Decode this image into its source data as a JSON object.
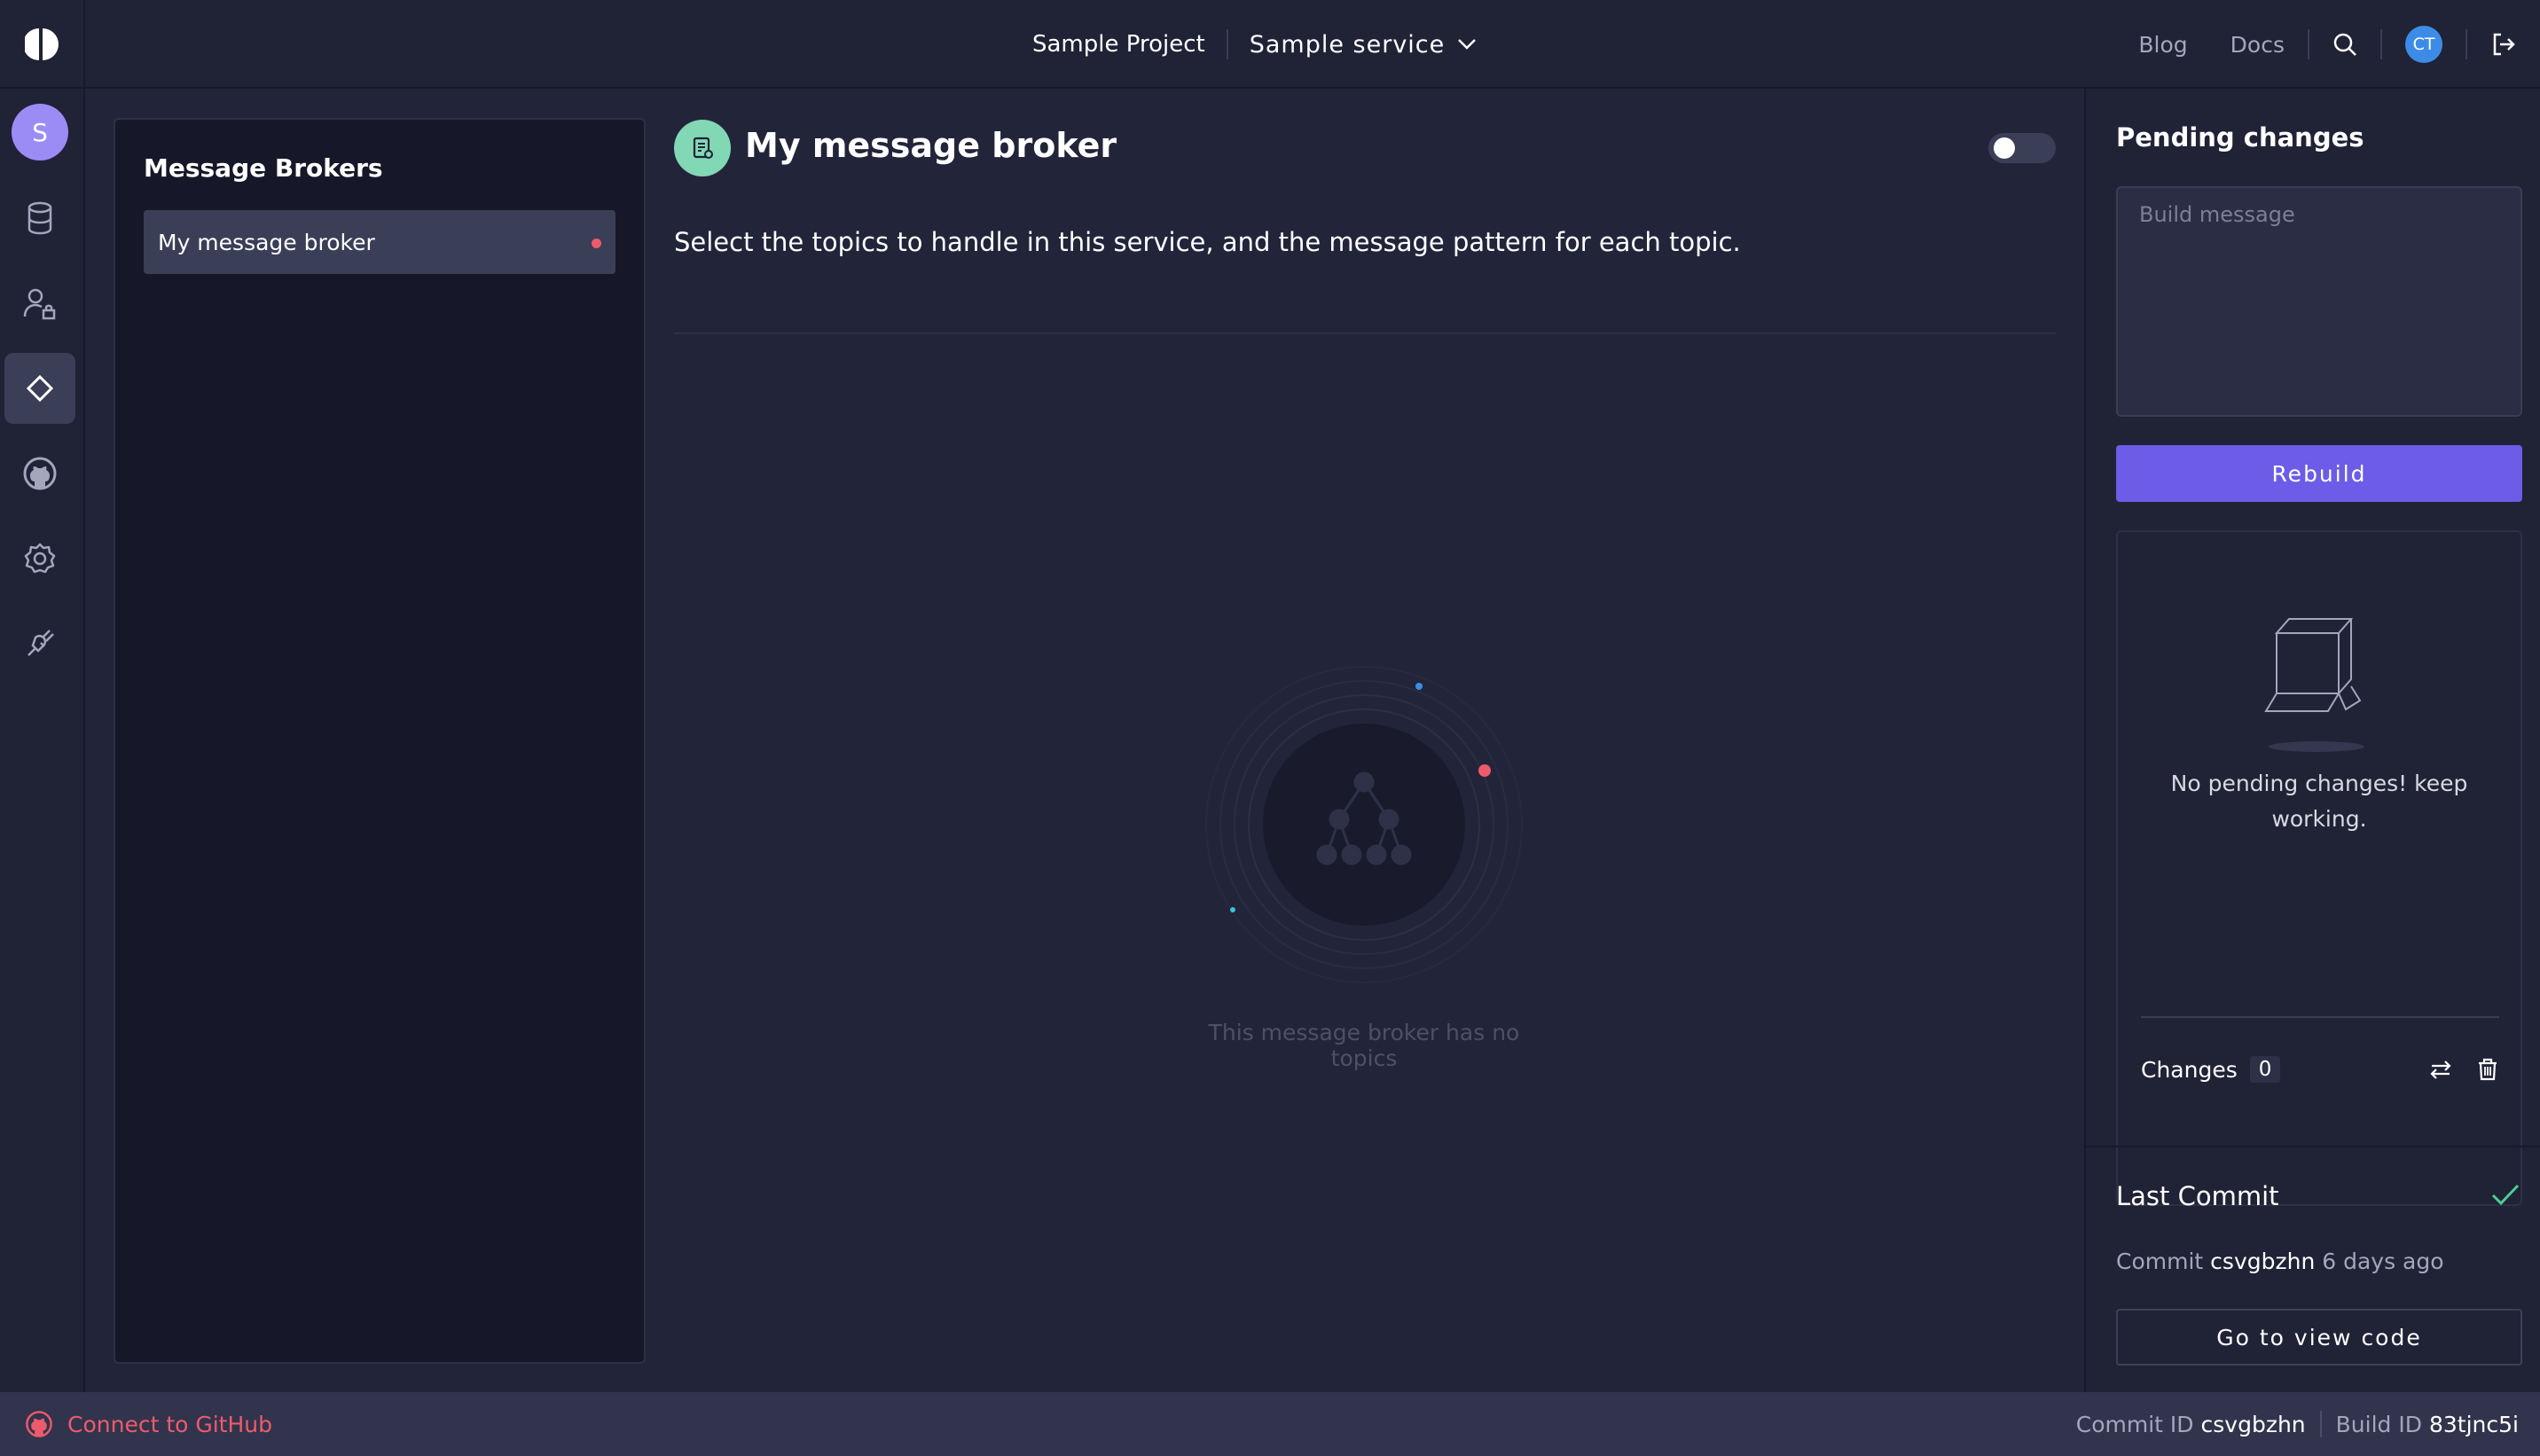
{
  "header": {
    "project": "Sample Project",
    "service": "Sample service",
    "links": [
      "Blog",
      "Docs"
    ],
    "user_initials": "CT"
  },
  "sidebar": {
    "workspace_initial": "S",
    "items": [
      {
        "name": "entities",
        "icon": "database-icon"
      },
      {
        "name": "roles",
        "icon": "user-lock-icon"
      },
      {
        "name": "plugins",
        "icon": "diamond-icon",
        "active": true
      },
      {
        "name": "github",
        "icon": "github-icon"
      },
      {
        "name": "settings",
        "icon": "gear-icon"
      },
      {
        "name": "connections",
        "icon": "plug-icon"
      }
    ]
  },
  "brokers_panel": {
    "title": "Message Brokers",
    "items": [
      {
        "label": "My message broker",
        "status_color": "#ec5b6c"
      }
    ]
  },
  "main": {
    "title": "My message broker",
    "enabled": false,
    "description": "Select the topics to handle in this service, and the message pattern for each topic.",
    "empty_message": "This message broker has no topics"
  },
  "pending_changes": {
    "title": "Pending changes",
    "build_message_placeholder": "Build message",
    "rebuild_label": "Rebuild",
    "empty_text": "No pending changes! keep working.",
    "changes_label": "Changes",
    "changes_count": "0"
  },
  "last_commit": {
    "title": "Last Commit",
    "commit_prefix": "Commit",
    "commit_hash": "csvgbzhn",
    "commit_age": "6 days ago",
    "view_code_label": "Go to view code"
  },
  "footer": {
    "connect_label": "Connect to GitHub",
    "commit_id_label": "Commit ID",
    "commit_id": "csvgbzhn",
    "build_id_label": "Build ID",
    "build_id": "83tjnc5i"
  },
  "colors": {
    "accent": "#6c5ce7",
    "danger": "#ec5b6c",
    "success": "#4ccf8f",
    "broker_icon_bg": "#82d8b4"
  }
}
